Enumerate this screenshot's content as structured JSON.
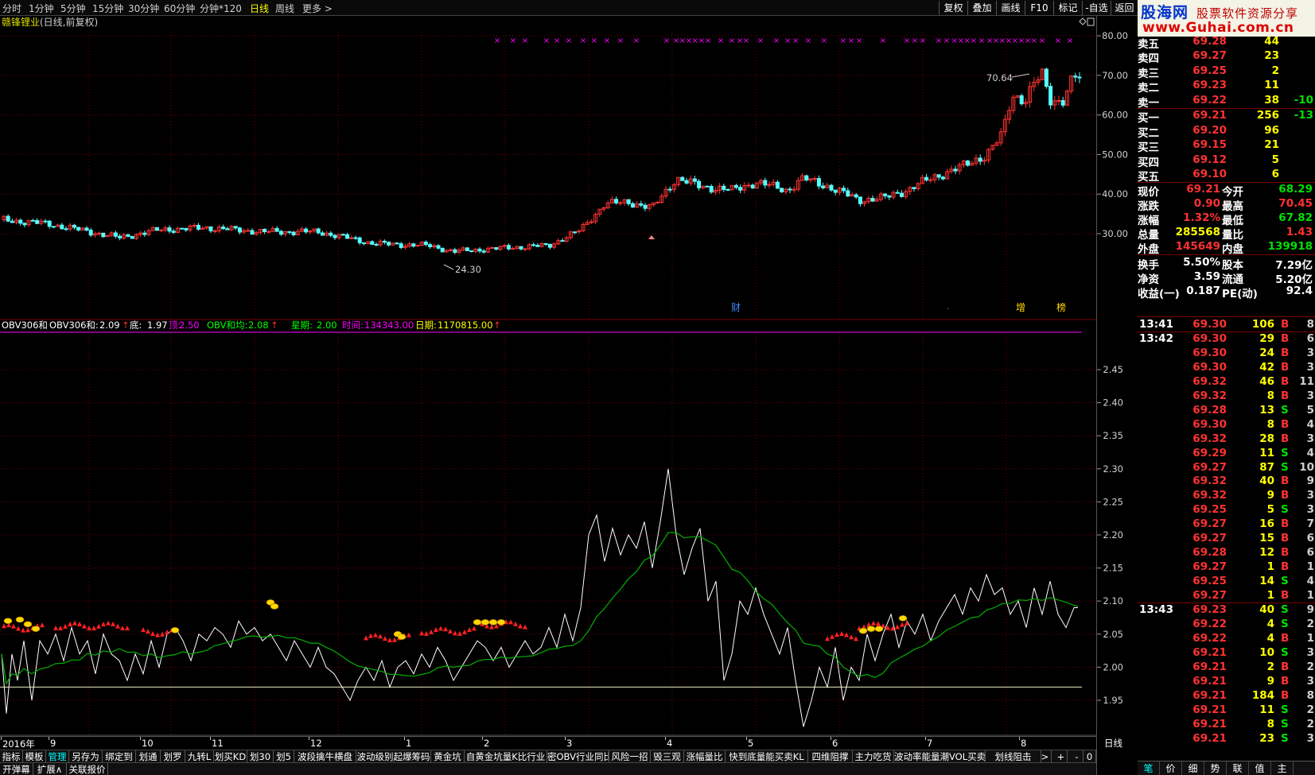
{
  "topbar": {
    "periods": [
      "分时",
      "1分钟",
      "5分钟",
      "15分钟",
      "30分钟",
      "60分钟",
      "分钟*120",
      "日线",
      "周线",
      "更多 >"
    ],
    "buttons": [
      "复权",
      "叠加",
      "画线",
      "F10",
      "标记",
      "-自选",
      "返回"
    ]
  },
  "logo": {
    "brand": "股海网",
    "slogan": "股票软件资源分享",
    "url": "www.Guhai.com.cn"
  },
  "main_chart": {
    "stock_name": "赣锋锂业",
    "subtitle": "(日线,前复权)",
    "high_label": "70.64",
    "low_label": "24.30",
    "event_marks": [
      "财",
      "增",
      "榜"
    ],
    "y_ticks": [
      "80.00",
      "70.00",
      "60.00",
      "50.00",
      "40.00",
      "30.00"
    ]
  },
  "indicator": {
    "name": "OBV306和",
    "line1_label": "OBV306和:",
    "line1_value": "2.09",
    "bottom_label": "底:",
    "bottom_value": "1.97",
    "top_label": "顶:",
    "top_value": "2.50",
    "avg_label": "OBV和均:",
    "avg_value": "2.08",
    "week_label": "星期:",
    "week_value": "2.00",
    "time_label": "时间:",
    "time_value": "134343.00",
    "date_label": "日期:",
    "date_value": "1170815.00",
    "y_ticks": [
      "2.45",
      "2.40",
      "2.35",
      "2.30",
      "2.25",
      "2.20",
      "2.15",
      "2.10",
      "2.05",
      "2.00",
      "1.95"
    ]
  },
  "date_axis": [
    "2016年",
    "9",
    "10",
    "11",
    "12",
    "1",
    "2",
    "3",
    "4",
    "5",
    "6",
    "7",
    "8"
  ],
  "period_label": "日线",
  "quote": {
    "sell": [
      {
        "label": "卖五",
        "price": "69.28",
        "vol": "44",
        "chg": ""
      },
      {
        "label": "卖四",
        "price": "69.27",
        "vol": "23",
        "chg": ""
      },
      {
        "label": "卖三",
        "price": "69.25",
        "vol": "2",
        "chg": ""
      },
      {
        "label": "卖二",
        "price": "69.23",
        "vol": "11",
        "chg": ""
      },
      {
        "label": "卖一",
        "price": "69.22",
        "vol": "38",
        "chg": "-10"
      }
    ],
    "buy": [
      {
        "label": "买一",
        "price": "69.21",
        "vol": "256",
        "chg": "-13"
      },
      {
        "label": "买二",
        "price": "69.20",
        "vol": "96",
        "chg": ""
      },
      {
        "label": "买三",
        "price": "69.15",
        "vol": "21",
        "chg": ""
      },
      {
        "label": "买四",
        "price": "69.12",
        "vol": "5",
        "chg": ""
      },
      {
        "label": "买五",
        "price": "69.10",
        "vol": "6",
        "chg": ""
      }
    ],
    "stats": [
      {
        "l1": "现价",
        "v1": "69.21",
        "l2": "今开",
        "v2": "68.29"
      },
      {
        "l1": "涨跌",
        "v1": "0.90",
        "l2": "最高",
        "v2": "70.45"
      },
      {
        "l1": "涨幅",
        "v1": "1.32%",
        "l2": "最低",
        "v2": "67.82"
      },
      {
        "l1": "总量",
        "v1": "285568",
        "l2": "量比",
        "v2": "1.43"
      },
      {
        "l1": "外盘",
        "v1": "145649",
        "l2": "内盘",
        "v2": "139918"
      }
    ],
    "stats2": [
      {
        "l1": "换手",
        "v1": "5.50%",
        "l2": "股本",
        "v2": "7.29亿"
      },
      {
        "l1": "净资",
        "v1": "3.59",
        "l2": "流通",
        "v2": "5.20亿"
      },
      {
        "l1": "收益(一)",
        "v1": "0.187",
        "l2": "PE(动)",
        "v2": "92.4"
      }
    ]
  },
  "ticks": [
    {
      "time": "13:41",
      "price": "69.30",
      "vol": "106",
      "bs": "B",
      "n": "8"
    },
    {
      "time": "13:42",
      "price": "69.30",
      "vol": "29",
      "bs": "B",
      "n": "6"
    },
    {
      "time": "",
      "price": "69.30",
      "vol": "24",
      "bs": "B",
      "n": "3"
    },
    {
      "time": "",
      "price": "69.30",
      "vol": "42",
      "bs": "B",
      "n": "3"
    },
    {
      "time": "",
      "price": "69.32",
      "vol": "46",
      "bs": "B",
      "n": "11"
    },
    {
      "time": "",
      "price": "69.32",
      "vol": "8",
      "bs": "B",
      "n": "3"
    },
    {
      "time": "",
      "price": "69.28",
      "vol": "13",
      "bs": "S",
      "n": "5"
    },
    {
      "time": "",
      "price": "69.30",
      "vol": "8",
      "bs": "B",
      "n": "4"
    },
    {
      "time": "",
      "price": "69.32",
      "vol": "28",
      "bs": "B",
      "n": "3"
    },
    {
      "time": "",
      "price": "69.29",
      "vol": "11",
      "bs": "S",
      "n": "4"
    },
    {
      "time": "",
      "price": "69.27",
      "vol": "87",
      "bs": "S",
      "n": "10"
    },
    {
      "time": "",
      "price": "69.32",
      "vol": "40",
      "bs": "B",
      "n": "9"
    },
    {
      "time": "",
      "price": "69.32",
      "vol": "9",
      "bs": "B",
      "n": "3"
    },
    {
      "time": "",
      "price": "69.25",
      "vol": "5",
      "bs": "S",
      "n": "3"
    },
    {
      "time": "",
      "price": "69.27",
      "vol": "16",
      "bs": "B",
      "n": "7"
    },
    {
      "time": "",
      "price": "69.27",
      "vol": "15",
      "bs": "B",
      "n": "6"
    },
    {
      "time": "",
      "price": "69.28",
      "vol": "12",
      "bs": "B",
      "n": "6"
    },
    {
      "time": "",
      "price": "69.27",
      "vol": "1",
      "bs": "B",
      "n": "1"
    },
    {
      "time": "",
      "price": "69.25",
      "vol": "14",
      "bs": "S",
      "n": "4"
    },
    {
      "time": "",
      "price": "69.27",
      "vol": "1",
      "bs": "B",
      "n": "1"
    },
    {
      "time": "13:43",
      "price": "69.23",
      "vol": "40",
      "bs": "S",
      "n": "9"
    },
    {
      "time": "",
      "price": "69.22",
      "vol": "4",
      "bs": "S",
      "n": "2"
    },
    {
      "time": "",
      "price": "69.22",
      "vol": "4",
      "bs": "B",
      "n": "1"
    },
    {
      "time": "",
      "price": "69.21",
      "vol": "10",
      "bs": "S",
      "n": "3"
    },
    {
      "time": "",
      "price": "69.21",
      "vol": "2",
      "bs": "B",
      "n": "2"
    },
    {
      "time": "",
      "price": "69.21",
      "vol": "9",
      "bs": "B",
      "n": "3"
    },
    {
      "time": "",
      "price": "69.21",
      "vol": "184",
      "bs": "B",
      "n": "8"
    },
    {
      "time": "",
      "price": "69.21",
      "vol": "11",
      "bs": "S",
      "n": "2"
    },
    {
      "time": "",
      "price": "69.21",
      "vol": "8",
      "bs": "S",
      "n": "2"
    },
    {
      "time": "",
      "price": "69.21",
      "vol": "23",
      "bs": "S",
      "n": "3"
    }
  ],
  "bottom_tabs": [
    "指标",
    "模板",
    "管理",
    "另存为",
    "绑定到",
    "划通",
    "划罗",
    "九转L",
    "划买KD",
    "划30",
    "划5",
    "波段擒牛横盘",
    "波动级别起爆筹码",
    "黄金坑",
    "自黄金坑量K比行业",
    "密OBV行业同比",
    "风险一招",
    "毁三观",
    "涨幅量比",
    "快到底量能买卖KL",
    "四维阻撑",
    "主力吃货",
    "波动率能量潮VOL买卖",
    "划线阻击"
  ],
  "bottom_tabs2": [
    "开弹幕",
    "扩展∧",
    "关联报价"
  ],
  "right_tabs": [
    "笔",
    "价",
    "细",
    "势",
    "联",
    "值",
    "主"
  ],
  "colors": {
    "up": "#ff3232",
    "down": "#54ffff",
    "ma": "#00b000",
    "obv": "#ffffff",
    "gold": "#ffd700",
    "grid": "#7a0000"
  }
}
